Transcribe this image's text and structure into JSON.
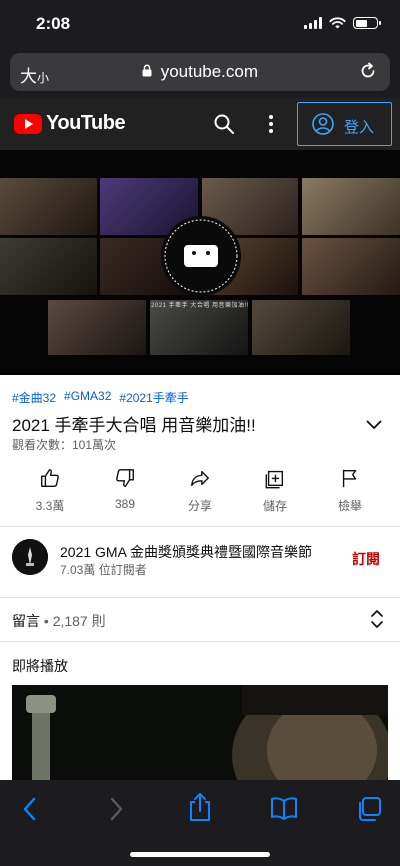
{
  "status_bar": {
    "time": "2:08"
  },
  "browser": {
    "text_size_label": "大",
    "text_size_small": "小",
    "url": "youtube.com"
  },
  "youtube_header": {
    "logo_text": "YouTube",
    "signin_label": "登入"
  },
  "player": {
    "emblem_text": "金曲32 GOLDEN MELODY AWARDS",
    "caption": "2021 手牽手 大合唱 用音樂加油!!"
  },
  "video": {
    "hashtags": [
      "#金曲32",
      "#GMA32",
      "#2021手牽手"
    ],
    "title": "2021 手牽手大合唱 用音樂加油!!",
    "views": "觀看次數：101萬次"
  },
  "actions": [
    {
      "icon": "thumbs-up-icon",
      "label": "3.3萬"
    },
    {
      "icon": "thumbs-down-icon",
      "label": "389"
    },
    {
      "icon": "share-icon",
      "label": "分享"
    },
    {
      "icon": "save-icon",
      "label": "儲存"
    },
    {
      "icon": "flag-icon",
      "label": "檢舉"
    }
  ],
  "channel": {
    "name": "2021 GMA 金曲獎頒獎典禮暨國際音樂節",
    "subscribers": "7.03萬 位訂閱者",
    "subscribe_label": "訂閱"
  },
  "comments": {
    "label": "留言",
    "separator": " • ",
    "count": "2,187 則"
  },
  "up_next": {
    "label": "即將播放"
  },
  "colors": {
    "youtube_red": "#ff0000",
    "link_blue": "#065fd4",
    "signin_blue": "#3ea6ff",
    "subscribe_red": "#cc0000",
    "safari_blue": "#0a84ff"
  }
}
